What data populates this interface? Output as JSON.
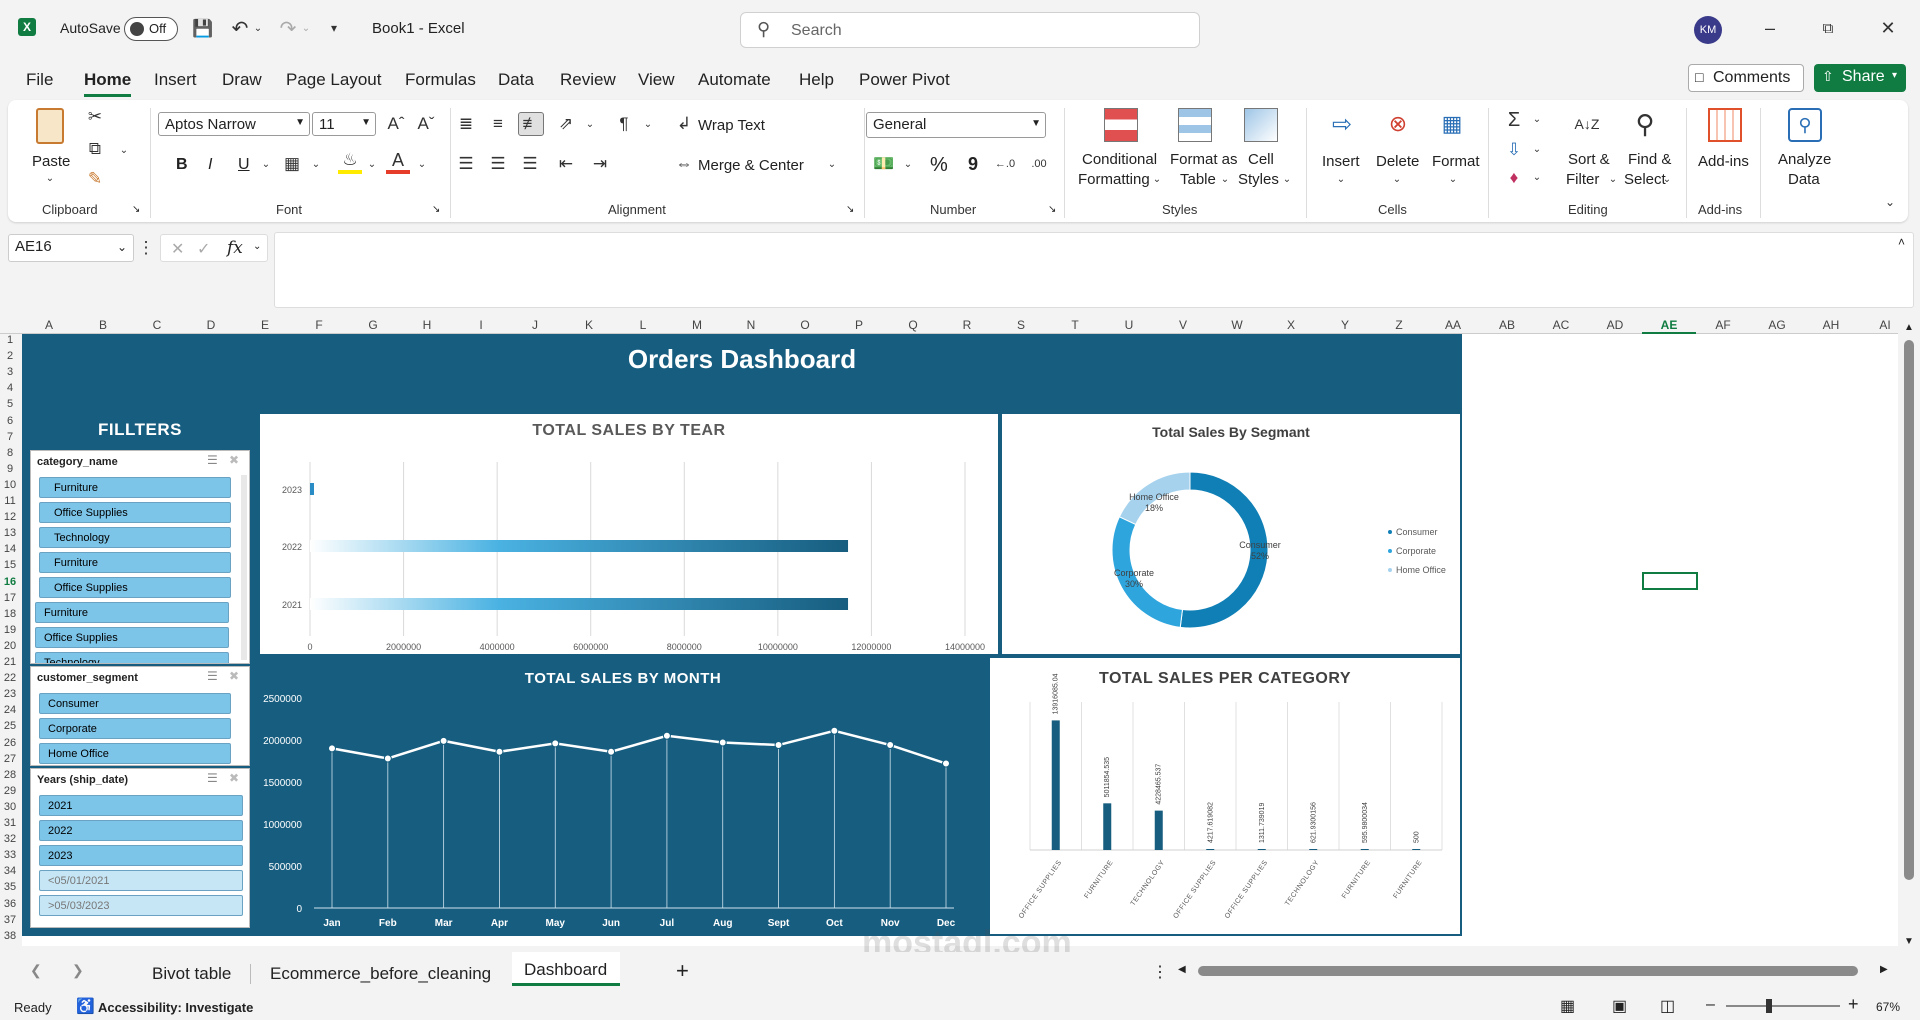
{
  "app": {
    "autosave_label": "AutoSave",
    "autosave_state": "Off",
    "doc_title": "Book1  -  Excel",
    "search_placeholder": "Search",
    "user_initials": "KM",
    "brand_color": "#107c41"
  },
  "menu": {
    "tabs": [
      "File",
      "Home",
      "Insert",
      "Draw",
      "Page Layout",
      "Formulas",
      "Data",
      "Review",
      "View",
      "Automate",
      "Help",
      "Power Pivot"
    ],
    "active": "Home",
    "comments": "Comments",
    "share": "Share"
  },
  "ribbon": {
    "clipboard": {
      "paste": "Paste",
      "label": "Clipboard"
    },
    "font": {
      "name": "Aptos Narrow",
      "size": "11",
      "bold": "B",
      "italic": "I",
      "underline": "U",
      "label": "Font"
    },
    "alignment": {
      "wrap": "Wrap Text",
      "merge": "Merge & Center",
      "label": "Alignment"
    },
    "number": {
      "format": "General",
      "label": "Number",
      "percent": "%",
      "comma": "9"
    },
    "styles": {
      "conditional": [
        "Conditional",
        "Formatting"
      ],
      "format_table": [
        "Format as",
        "Table"
      ],
      "cell_styles": [
        "Cell",
        "Styles"
      ],
      "label": "Styles"
    },
    "cells": {
      "insert": "Insert",
      "delete": "Delete",
      "format": "Format",
      "label": "Cells"
    },
    "editing": {
      "sort": [
        "Sort &",
        "Filter"
      ],
      "find": [
        "Find &",
        "Select"
      ],
      "label": "Editing"
    },
    "addins": {
      "addins": "Add-ins",
      "label": "Add-ins"
    },
    "analyze": {
      "label": [
        "Analyze",
        "Data"
      ]
    }
  },
  "formula": {
    "name_box": "AE16",
    "fx": "fx",
    "value": ""
  },
  "columns": [
    "A",
    "B",
    "C",
    "D",
    "E",
    "F",
    "G",
    "H",
    "I",
    "J",
    "K",
    "L",
    "M",
    "N",
    "O",
    "P",
    "Q",
    "R",
    "S",
    "T",
    "U",
    "V",
    "W",
    "X",
    "Y",
    "Z",
    "AA",
    "AB",
    "AC",
    "AD",
    "AE",
    "AF",
    "AG",
    "AH",
    "AI"
  ],
  "active_col": "AE",
  "active_row": "16",
  "rows": [
    "1",
    "2",
    "3",
    "4",
    "5",
    "6",
    "7",
    "8",
    "9",
    "10",
    "11",
    "12",
    "13",
    "14",
    "15",
    "16",
    "17",
    "18",
    "19",
    "20",
    "21",
    "22",
    "23",
    "24",
    "25",
    "26",
    "27",
    "28",
    "29",
    "30",
    "31",
    "32",
    "33",
    "34",
    "35",
    "36",
    "37",
    "38"
  ],
  "dashboard": {
    "title": "Orders Dashboard",
    "filters_title": "FILLTERS",
    "theme": {
      "dark": "#175d7f",
      "light": "#7cc4e8"
    },
    "slicers": [
      {
        "header": "category_name",
        "items": [
          "Furniture",
          "Office Supplies",
          "Technology",
          "Furniture",
          "Office Supplies",
          "Furniture",
          "Office Supplies",
          "Technology"
        ]
      },
      {
        "header": "customer_segment",
        "items": [
          "Consumer",
          "Corporate",
          "Home Office"
        ]
      },
      {
        "header": "Years (ship_date)",
        "items": [
          "2021",
          "2022",
          "2023",
          "<05/01/2021",
          ">05/03/2023"
        ],
        "dim_from": 3
      }
    ]
  },
  "chart_data": [
    {
      "type": "bar",
      "title": "TOTAL SALES BY TEAR",
      "categories": [
        "2023",
        "2022",
        "2021"
      ],
      "values": [
        80000,
        11500000,
        11500000
      ],
      "xlim": [
        0,
        14000000
      ],
      "ticks": [
        "0",
        "2000000",
        "4000000",
        "6000000",
        "8000000",
        "10000000",
        "12000000",
        "14000000"
      ]
    },
    {
      "type": "pie",
      "title": "Total Sales By Segmant",
      "labels": [
        "Consumer",
        "Corporate",
        "Home Office"
      ],
      "values": [
        52,
        30,
        18
      ],
      "slice_labels": [
        "Consumer\n52%",
        "Corporate\n30%",
        "Home Office\n18%"
      ],
      "colors": [
        "#0f7fb6",
        "#2fa5de",
        "#a6d2ee"
      ],
      "legend": [
        "Consumer",
        "Corporate",
        "Home Office"
      ]
    },
    {
      "type": "line",
      "title": "TOTAL SALES BY MONTH",
      "categories": [
        "Jan",
        "Feb",
        "Mar",
        "Apr",
        "May",
        "Jun",
        "Jul",
        "Aug",
        "Sept",
        "Oct",
        "Nov",
        "Dec"
      ],
      "values": [
        1900000,
        1780000,
        1990000,
        1860000,
        1960000,
        1860000,
        2050000,
        1970000,
        1940000,
        2110000,
        1940000,
        1720000
      ],
      "ylim": [
        0,
        2500000
      ],
      "ticks": [
        "0",
        "500000",
        "1000000",
        "1500000",
        "2000000",
        "2500000"
      ]
    },
    {
      "type": "bar",
      "title": "TOTAL SALES PER CATEGORY",
      "categories": [
        "OFFICE SUPPLIES",
        "FURNITURE",
        "TECHNOLOGY",
        "OFFICE SUPPLIES",
        "OFFICE SUPPLIES",
        "TECHNOLOGY",
        "FURNITURE",
        "FURNITURE"
      ],
      "values": [
        13916085.04,
        5011854.535,
        4228465.537,
        4217.619082,
        1311.739019,
        621.9300156,
        595.9800034,
        500
      ],
      "data_labels": [
        "13916085.04",
        "5011854.535",
        "4228465.537",
        "4217.619082",
        "1311.739019",
        "621.9300156",
        "595.9800034",
        "500"
      ]
    }
  ],
  "sheets": {
    "tabs": [
      "Bivot table",
      "Ecommerce_before_cleaning",
      "Dashboard"
    ],
    "active": "Dashboard"
  },
  "status": {
    "ready": "Ready",
    "accessibility": "Accessibility: Investigate",
    "zoom": "67%"
  },
  "watermark": {
    "text": "mostaql.com"
  }
}
